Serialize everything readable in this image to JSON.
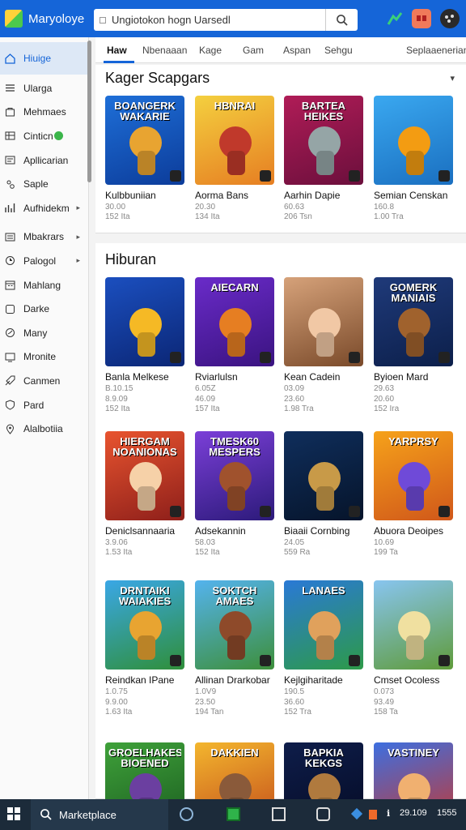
{
  "app": {
    "title": "Maryoloye"
  },
  "search": {
    "value": "Ungiotokon hogn Uarsedl"
  },
  "icons": {
    "brand": "logo-icon",
    "search": "search-icon",
    "game_controller": "controller-icon",
    "profile": "profile-icon",
    "extensions": "puzzle-icon"
  },
  "colors": {
    "accent": "#1565d8",
    "taskbar": "#1c2b3a"
  },
  "sidebar": {
    "items": [
      {
        "label": "Hiuige",
        "icon": "home-icon",
        "active": true
      },
      {
        "label": "Ularga",
        "icon": "bars-icon"
      },
      {
        "label": "Mehmaes",
        "icon": "box-icon"
      },
      {
        "label": "Cinticn",
        "icon": "grid-icon",
        "badge": true
      },
      {
        "label": "Apllicarian",
        "icon": "app-icon"
      },
      {
        "label": "Saple",
        "icon": "people-icon"
      },
      {
        "label": "Aufhidekm",
        "icon": "chart-icon",
        "chevron": true
      },
      {
        "label": "Mbakrars",
        "icon": "list-icon",
        "chevron": true
      },
      {
        "label": "Palogol",
        "icon": "clock-icon",
        "chevron": true
      },
      {
        "label": "Mahlang",
        "icon": "calendar-icon"
      },
      {
        "label": "Darke",
        "icon": "square-icon"
      },
      {
        "label": "Many",
        "icon": "gauge-icon"
      },
      {
        "label": "Mronite",
        "icon": "monitor-icon"
      },
      {
        "label": "Canmen",
        "icon": "tag-icon"
      },
      {
        "label": "Pard",
        "icon": "shield-icon"
      },
      {
        "label": "Alalbotiia",
        "icon": "pin-icon"
      }
    ]
  },
  "tabs": [
    "Haw",
    "Nbenaaan",
    "Kage",
    "Gam",
    "Aspan",
    "Sehgu",
    "Seplaaenerians"
  ],
  "sections": [
    {
      "title": "Kager Scapgars",
      "games": [
        {
          "name": "Kulbbuniian",
          "meta": "30.00",
          "count": "152 Ita",
          "art_title": "BOANGERK WAKARIE",
          "bg": [
            "#1e6fd8",
            "#0c3c9a"
          ],
          "char": "#e8a431"
        },
        {
          "name": "Aorma Bans",
          "meta": "20.30",
          "count": "134 Ita",
          "art_title": "HBNRAI",
          "bg": [
            "#f4d03f",
            "#e67e22"
          ],
          "char": "#c0392b"
        },
        {
          "name": "Aarhin Dapie",
          "meta": "60.63",
          "count": "206 Tsn",
          "art_title": "BARTEA HEIKES",
          "bg": [
            "#b01c57",
            "#6b0f3c"
          ],
          "char": "#95a5a6"
        },
        {
          "name": "Semian Censkan",
          "meta": "160.8",
          "count": "1.00 Tra",
          "art_title": "",
          "bg": [
            "#3aa8f0",
            "#1a6fc0"
          ],
          "char": "#f39c12"
        }
      ]
    },
    {
      "title": "Hiburan",
      "games": [
        {
          "name": "Banla Melkese",
          "meta": "B.10.15",
          "meta2": "8.9.09",
          "count": "152 Ita",
          "art_title": "",
          "bg": [
            "#1b4fbf",
            "#0b2675"
          ],
          "char": "#f5b925"
        },
        {
          "name": "Rviarlulsn",
          "meta": "6.05Z",
          "meta2": "46.09",
          "count": "157 Ita",
          "art_title": "AIECARN",
          "bg": [
            "#6a2bc9",
            "#3a1380"
          ],
          "char": "#e67e22"
        },
        {
          "name": "Kean Cadein",
          "meta": "03.09",
          "meta2": "23.60",
          "count": "1.98 Tra",
          "art_title": "",
          "bg": [
            "#d6a27a",
            "#7a4a2a"
          ],
          "char": "#f1c8a5"
        },
        {
          "name": "Byioen Mard",
          "meta": "29.63",
          "meta2": "20.60",
          "count": "152 Ira",
          "art_title": "GOMERK MANIAIS",
          "bg": [
            "#1f3a7a",
            "#0c1f4a"
          ],
          "char": "#a0622d"
        },
        {
          "name": "Deniclsannaaria",
          "meta": "3.9.06",
          "count": "1.53 Ita",
          "art_title": "HIERGAM NOANIONAS",
          "bg": [
            "#e8542f",
            "#8e1f1a"
          ],
          "char": "#f6d1a8"
        },
        {
          "name": "Adsekannin",
          "meta": "58.03",
          "count": "152 Ita",
          "art_title": "TMESK60 MESPERS",
          "bg": [
            "#7b3fd8",
            "#2c1a7a"
          ],
          "char": "#a0522d"
        },
        {
          "name": "Biaaii Cornbing",
          "meta": "24.05",
          "count": "559 Ra",
          "art_title": "",
          "bg": [
            "#0f2e5c",
            "#06142a"
          ],
          "char": "#c89a48"
        },
        {
          "name": "Abuora Deoipes",
          "meta": "10.69",
          "count": "199 Ta",
          "art_title": "YARPRSY",
          "bg": [
            "#f6a21a",
            "#d0571a"
          ],
          "char": "#6f4ad8"
        },
        {
          "name": "Reindkan IPane",
          "meta": "1.0.75",
          "meta2": "9.9.00",
          "count": "1.63 Ita",
          "art_title": "DRNTAIKI WAIAKIES",
          "bg": [
            "#3aa7e6",
            "#2f8f3a"
          ],
          "char": "#e8a431"
        },
        {
          "name": "Allinan Drarkobar",
          "meta": "1.0V9",
          "meta2": "23.50",
          "count": "194 Tan",
          "art_title": "SOKTCH AMAES",
          "bg": [
            "#54b3ee",
            "#3d8f3a"
          ],
          "char": "#8e4a2a"
        },
        {
          "name": "Kejlgiharitade",
          "meta": "190.5",
          "meta2": "36.60",
          "count": "152 Tra",
          "art_title": "LANAES",
          "bg": [
            "#2a79d6",
            "#2d9a49"
          ],
          "char": "#e0a15c"
        },
        {
          "name": "Cmset Ocoless",
          "meta": "0.073",
          "meta2": "93.49",
          "count": "158 Ta",
          "art_title": "",
          "bg": [
            "#88c5f0",
            "#5f9b3a"
          ],
          "char": "#f0e0a0"
        },
        {
          "name": "",
          "meta": "",
          "count": "",
          "art_title": "GROELHAKES BIOENED",
          "bg": [
            "#3fa13a",
            "#1a5c1f"
          ],
          "char": "#6b3fa0"
        },
        {
          "name": "",
          "meta": "",
          "count": "",
          "art_title": "DAKKIEN",
          "bg": [
            "#f3b62e",
            "#c24a1a"
          ],
          "char": "#8a5a3a"
        },
        {
          "name": "",
          "meta": "",
          "count": "",
          "art_title": "BAPKIA KEKGS",
          "bg": [
            "#0e1d4a",
            "#050b24"
          ],
          "char": "#b07a3e"
        },
        {
          "name": "",
          "meta": "",
          "count": "",
          "art_title": "VASTINEY",
          "bg": [
            "#3d6fe0",
            "#c8372e"
          ],
          "char": "#f0b070"
        }
      ]
    }
  ],
  "taskbar": {
    "search_label": "Marketplace",
    "time": "29.109",
    "date": "1555"
  }
}
